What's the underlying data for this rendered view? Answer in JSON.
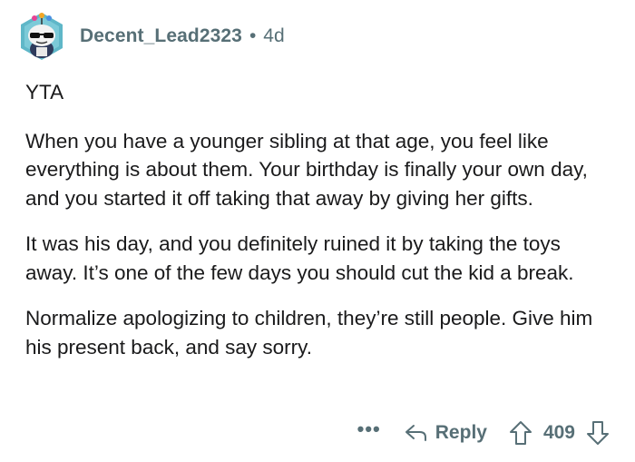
{
  "comment": {
    "username": "Decent_Lead2323",
    "separator": "•",
    "age": "4d",
    "paragraphs": [
      "YTA",
      "When you have a younger sibling at that age, you feel like everything is about them. Your birthday is finally your own day, and you started it off taking that away by giving her gifts.",
      "It was his day, and you definitely ruined it by taking the toys away. It’s one of the few days you should cut the kid a break.",
      "Normalize apologizing to children, they’re still people. Give him his present back, and say sorry."
    ],
    "actions": {
      "more": "•••",
      "reply_label": "Reply",
      "vote_count": "409"
    }
  },
  "icons": {
    "avatar": "snoo-avatar-sunglasses",
    "reply": "reply-arrow-icon",
    "upvote": "upvote-arrow-icon",
    "downvote": "downvote-arrow-icon"
  },
  "colors": {
    "meta_text": "#576f76",
    "body_text": "#1a1a1b",
    "avatar_bg": "#5fb7c8"
  }
}
